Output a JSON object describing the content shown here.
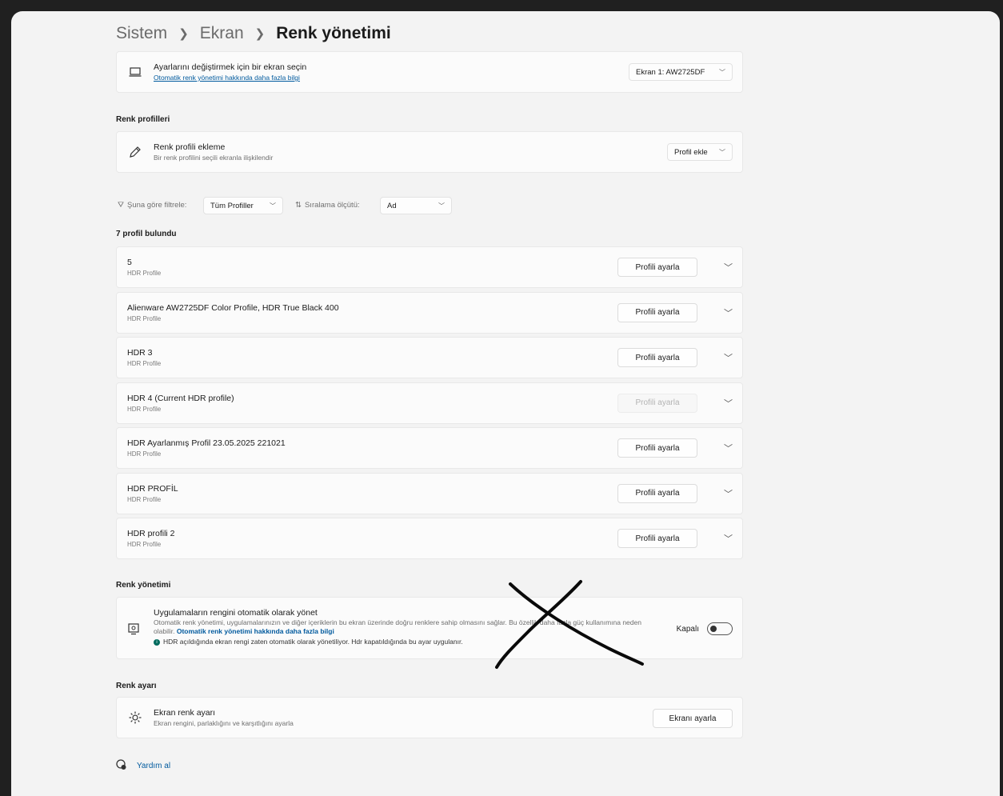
{
  "breadcrumb": {
    "item1": "Sistem",
    "item2": "Ekran",
    "current": "Renk yönetimi"
  },
  "display_select": {
    "title": "Ayarlarını değiştirmek için bir ekran seçin",
    "link": "Otomatik renk yönetimi hakkında daha fazla bilgi",
    "value": "Ekran 1: AW2725DF"
  },
  "profiles_section": {
    "title": "Renk profilleri",
    "add_title": "Renk profili ekleme",
    "add_sub": "Bir renk profilini seçili ekranla ilişkilendir",
    "add_button": "Profil ekle"
  },
  "filters": {
    "filter_label": "Şuna göre filtrele:",
    "filter_value": "Tüm Profiller",
    "sort_label": "Sıralama ölçütü:",
    "sort_value": "Ad"
  },
  "found_count": "7 profil bulundu",
  "profiles": [
    {
      "name": "5",
      "type": "HDR Profile",
      "button": "Profili ayarla",
      "disabled": false
    },
    {
      "name": "Alienware AW2725DF Color Profile, HDR True Black 400",
      "type": "HDR Profile",
      "button": "Profili ayarla",
      "disabled": false
    },
    {
      "name": "HDR 3",
      "type": "HDR Profile",
      "button": "Profili ayarla",
      "disabled": false
    },
    {
      "name": "HDR 4 (Current HDR profile)",
      "type": "HDR Profile",
      "button": "Profili ayarla",
      "disabled": true
    },
    {
      "name": "HDR Ayarlanmış Profil 23.05.2025 221021",
      "type": "HDR Profile",
      "button": "Profili ayarla",
      "disabled": false
    },
    {
      "name": "HDR PROFİL",
      "type": "HDR Profile",
      "button": "Profili ayarla",
      "disabled": false
    },
    {
      "name": "HDR profili 2",
      "type": "HDR Profile",
      "button": "Profili ayarla",
      "disabled": false
    }
  ],
  "color_management": {
    "section_title": "Renk yönetimi",
    "title": "Uygulamaların rengini otomatik olarak yönet",
    "desc": "Otomatik renk yönetimi, uygulamalarınızın ve diğer içeriklerin bu ekran üzerinde doğru renklere sahip olmasını sağlar. Bu özellik daha fazla güç kullanımına neden olabilir.",
    "desc_link": "Otomatik renk yönetimi hakkında daha fazla bilgi",
    "info": "HDR açıldığında ekran rengi zaten otomatik olarak yönetiliyor. Hdr kapatıldığında bu ayar uygulanır.",
    "toggle_label": "Kapalı"
  },
  "calibration": {
    "section_title": "Renk ayarı",
    "title": "Ekran renk ayarı",
    "sub": "Ekran rengini, parlaklığını ve karşıtlığını ayarla",
    "button": "Ekranı ayarla"
  },
  "help": {
    "label": "Yardım al"
  }
}
